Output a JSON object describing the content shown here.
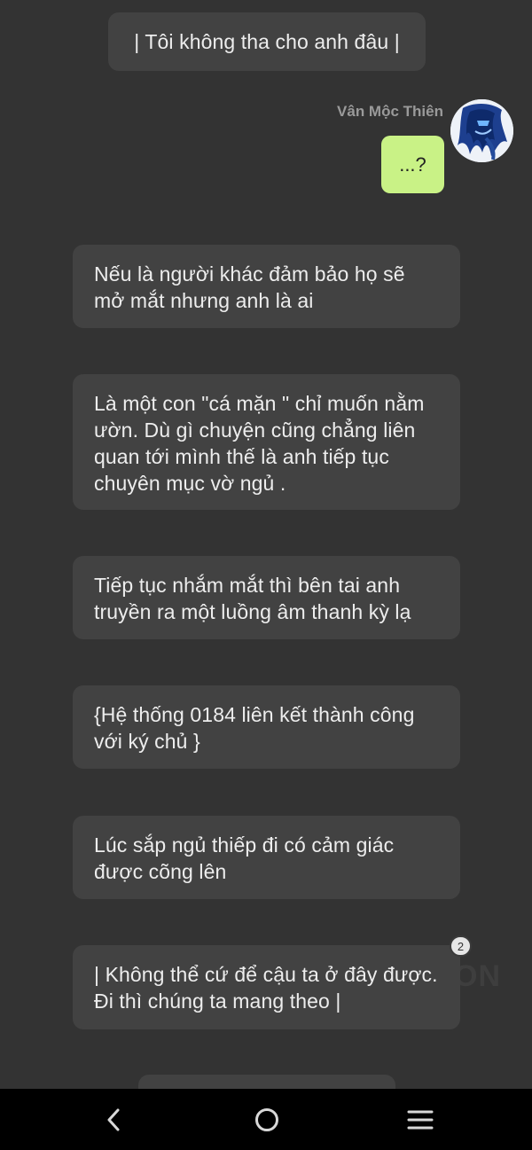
{
  "chat": {
    "system_bubble_top": "| Tôi không tha cho anh đâu |",
    "sender_name": "Vân Mộc Thiên",
    "my_message": "...?",
    "narration": [
      "Nếu là người khác đảm bảo họ sẽ mở mắt nhưng anh là ai",
      "Là một con \"cá mặn \" chỉ muốn nằm ườn. Dù gì chuyện cũng chẳng liên quan tới mình thế là anh tiếp tục chuyên mục vờ ngủ .",
      "Tiếp tục nhắm mắt thì bên tai anh truyền ra một luồng âm thanh kỳ lạ",
      "{Hệ thống 0184 liên kết thành công với ký chủ }",
      "Lúc sắp ngủ thiếp đi có cảm giác được cõng lên",
      "| Không thể cứ để cậu ta ở đây được. Đi thì chúng ta mang theo  |"
    ],
    "comment_count": "2",
    "watermark": "ON"
  },
  "navbar": {
    "back_icon": "back-chevron-icon",
    "home_icon": "home-circle-icon",
    "recents_icon": "recents-lines-icon"
  },
  "colors": {
    "background": "#333333",
    "bubble": "#424242",
    "my_bubble": "#c9f286",
    "navbar": "#000000"
  }
}
